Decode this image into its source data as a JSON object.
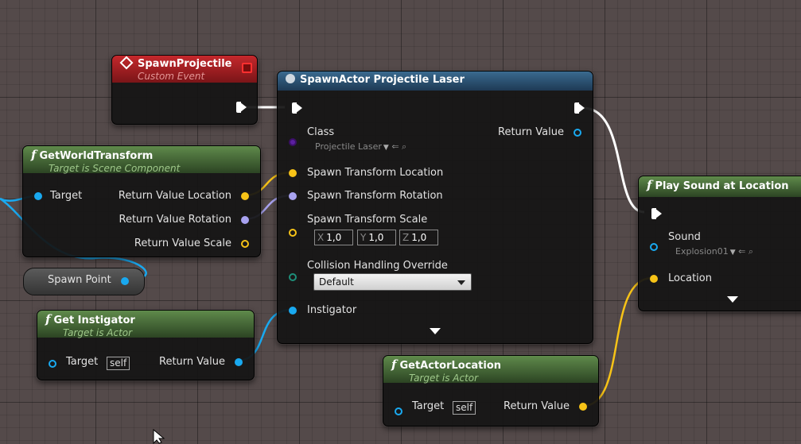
{
  "nodes": {
    "spawn_projectile": {
      "title": "SpawnProjectile",
      "subtitle": "Custom Event"
    },
    "get_world_transform": {
      "title": "GetWorldTransform",
      "subtitle": "Target is Scene Component",
      "pins": {
        "target": "Target",
        "loc": "Return Value Location",
        "rot": "Return Value Rotation",
        "scale": "Return Value Scale"
      }
    },
    "spawn_point": {
      "label": "Spawn Point"
    },
    "get_instigator": {
      "title": "Get Instigator",
      "subtitle": "Target is Actor",
      "target": "Target",
      "self": "self",
      "return": "Return Value"
    },
    "spawn_actor": {
      "title": "SpawnActor Projectile Laser",
      "class_label": "Class",
      "class_value": "Projectile Laser",
      "return": "Return Value",
      "loc": "Spawn Transform Location",
      "rot": "Spawn Transform Rotation",
      "scale": "Spawn Transform Scale",
      "scale_x_axis": "X",
      "scale_x": "1,0",
      "scale_y_axis": "Y",
      "scale_y": "1,0",
      "scale_z_axis": "Z",
      "scale_z": "1,0",
      "collision": "Collision Handling Override",
      "collision_value": "Default",
      "instigator": "Instigator"
    },
    "get_actor_location": {
      "title": "GetActorLocation",
      "subtitle": "Target is Actor",
      "target": "Target",
      "self": "self",
      "return": "Return Value"
    },
    "play_sound": {
      "title": "Play Sound at Location",
      "sound": "Sound",
      "sound_value": "Explosion01",
      "location": "Location"
    }
  },
  "colors": {
    "exec": "#ffffff",
    "object": "#19a9f0",
    "vector": "#f7c317",
    "rotator": "#a8a2f0",
    "class": "#5b1fa0",
    "event_header": "#c5282c",
    "function_header": "#5f8a4b"
  }
}
